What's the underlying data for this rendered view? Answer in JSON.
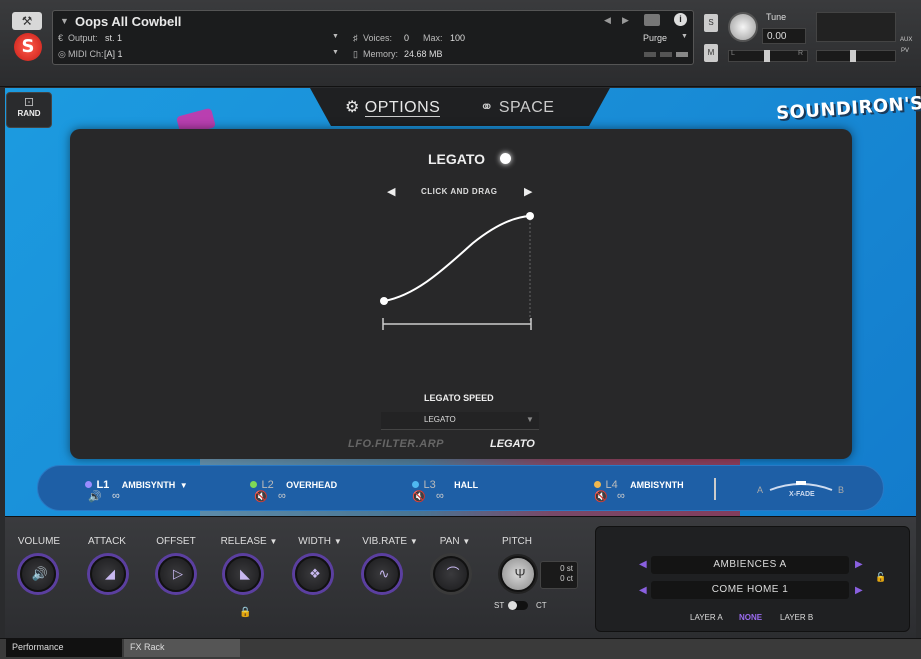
{
  "header": {
    "instrument_name": "Oops All Cowbell",
    "output_label": "Output:",
    "output_value": "st. 1",
    "midi_label": "MIDI Ch:",
    "midi_value": "[A] 1",
    "voices_label": "Voices:",
    "voices_value": "0",
    "max_label": "Max:",
    "max_value": "100",
    "memory_label": "Memory:",
    "memory_value": "24.68 MB",
    "purge_label": "Purge",
    "solo_label": "S",
    "mute_label": "M",
    "tune_label": "Tune",
    "tune_value": "0.00",
    "pan_left": "L",
    "pan_right": "R",
    "aux_label": "AUX",
    "pv_label": "PV"
  },
  "rand_label": "RAND",
  "tabs": {
    "options": "OPTIONS",
    "space": "SPACE"
  },
  "brand": "SOUNDIRON'S",
  "legato_panel": {
    "title": "LEGATO",
    "nav_label": "CLICK AND DRAG",
    "speed_label": "LEGATO SPEED",
    "speed_value": "LEGATO",
    "mode_inactive": "LFO.FILTER.ARP",
    "mode_active": "LEGATO"
  },
  "layers": [
    {
      "id": "L1",
      "name": "AMBISYNTH",
      "color": "#9a8cff"
    },
    {
      "id": "L2",
      "name": "OVERHEAD",
      "color": "#7ed957"
    },
    {
      "id": "L3",
      "name": "HALL",
      "color": "#4fb8f0"
    },
    {
      "id": "L4",
      "name": "AMBISYNTH",
      "color": "#f0b84f"
    }
  ],
  "xfade": {
    "a": "A",
    "b": "B",
    "label": "X-FADE"
  },
  "controls": {
    "volume": "VOLUME",
    "attack": "ATTACK",
    "offset": "OFFSET",
    "release": "RELEASE",
    "width": "WIDTH",
    "vibrate": "VIB.RATE",
    "pan": "PAN",
    "pitch": "PITCH",
    "pitch_st": "0 st",
    "pitch_ct": "0 ct",
    "st_label": "ST",
    "ct_label": "CT"
  },
  "presets": {
    "field1": "AMBIENCES A",
    "field2": "COME HOME 1",
    "layer_a": "LAYER A",
    "none": "NONE",
    "layer_b": "LAYER B"
  },
  "statusbar": {
    "tab1": "Performance",
    "tab2": "FX Rack"
  }
}
